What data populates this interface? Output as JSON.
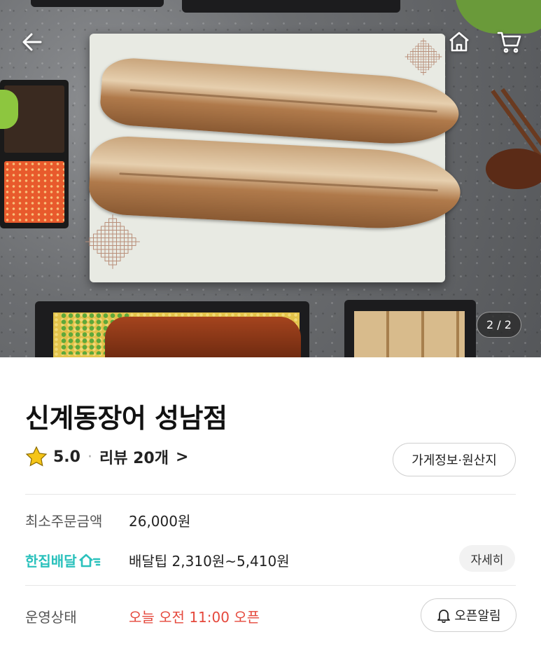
{
  "hero": {
    "counter": "2 / 2"
  },
  "store": {
    "name": "신계동장어 성남점",
    "rating": "5.0",
    "dot": "·",
    "reviews": "리뷰 20개",
    "chevron": ">",
    "info_button": "가게정보·원산지"
  },
  "info": {
    "min_order_label": "최소주문금액",
    "min_order_value": "26,000원",
    "delivery_brand": "한집배달",
    "delivery_tip": "배달팁 2,310원~5,410원",
    "detail_button": "자세히",
    "status_label": "운영상태",
    "status_value": "오늘 오전 11:00 오픈",
    "alarm_button": "오픈알림"
  },
  "icons": {
    "back": "back-arrow-icon",
    "home": "home-icon",
    "cart": "cart-icon",
    "star": "star-icon",
    "bell": "bell-icon",
    "delivery": "house-speed-icon"
  },
  "colors": {
    "brand_teal": "#2ac1bc",
    "status_red": "#e5483c",
    "star_yellow": "#f5c518"
  }
}
